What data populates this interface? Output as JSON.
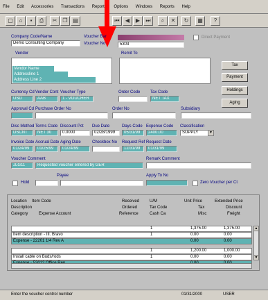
{
  "menu": [
    "File",
    "Edit",
    "Accessories",
    "Transactions",
    "Reports",
    "Options",
    "Windows",
    "Reports",
    "Help"
  ],
  "toolbar": [
    "new",
    "open",
    "save",
    "print",
    "cut",
    "copy",
    "paste",
    "first",
    "prev",
    "next",
    "last",
    "find",
    "delete",
    "refresh",
    "calc",
    "help"
  ],
  "header": {
    "company_label": "Company Code/Name",
    "company_code": "Demo Consulting Company",
    "vendor_label": "Vendor",
    "vendor_name": "Vendor Name",
    "vendor_address": [
      "Addressline 1",
      "Address Line 2"
    ],
    "voucher_label": "Voucher Bar",
    "voucher_no_label": "Voucher No",
    "voucher_no": "5303",
    "remit_label": "Remit To",
    "check_label": "Direct Payment"
  },
  "side_buttons": [
    "Tax",
    "Payment",
    "Holdings",
    "Aging"
  ],
  "row1": {
    "labels": [
      "Currency Cd",
      "Vendor Cont",
      "Voucher Type",
      "Order Code",
      "Tax Code"
    ],
    "values": [
      "USD",
      "AAB",
      "1 - VOUCHER",
      "",
      "NET TAX"
    ]
  },
  "row2": {
    "labels": [
      "Approval Cd",
      "Purchase Order No",
      "Order No",
      "Subsidiary"
    ]
  },
  "row3": {
    "labels": [
      "Disc Method",
      "Terms Code",
      "Discount Pct",
      "Due Date",
      "Days Code",
      "Expense Code",
      "Classification"
    ],
    "values": [
      "DSCNT",
      "NET 30",
      "0.0000",
      "02/28/1999",
      "05/31/99",
      "2400.00",
      "SUPPLY"
    ]
  },
  "row4": {
    "labels": [
      "Invoice Date",
      "Accrual Date",
      "Aging Date",
      "Checkbox No",
      "Request Ref",
      "Request Date"
    ],
    "values": [
      "01/24/99",
      "01/25/99",
      "01/24/99",
      "",
      "12/31/99",
      "01/31/99"
    ]
  },
  "row5": {
    "labels": [
      "Voucher Comment",
      "Remark Comment"
    ],
    "values": [
      "JLG11",
      "Requested voucher entered by GER"
    ]
  },
  "row6": {
    "hold_label": "Hold",
    "payee_label": "Payee",
    "apply_label": "Apply To No",
    "zero_label": "Zero Voucher per Ct"
  },
  "grid_header": {
    "line1": [
      "Location",
      "Item Code",
      "Received",
      "U/M",
      "Unit Price",
      "Extended Price"
    ],
    "line2": [
      "Description",
      "Ordered",
      "Tax Code",
      "Tax",
      "Discount"
    ],
    "line3": [
      "Category",
      "Expense Account",
      "Reference",
      "Cash Ca",
      "Misc",
      "Freight"
    ]
  },
  "grid_rows": [
    {
      "a": "",
      "b": "1",
      "c": "1,375.00",
      "d": "1,375.00",
      "hl": false
    },
    {
      "a": "Item description - III. Bravo",
      "b": "1",
      "c": "0.00",
      "d": "0.00",
      "hl": false
    },
    {
      "a": "Expense - 22201 1/4 Rev A",
      "b": "",
      "c": "0.00",
      "d": "0.00",
      "hl": true
    },
    {
      "a": "",
      "b": "1",
      "c": "1,200.00",
      "d": "1,000.00",
      "hl": false
    },
    {
      "a": "Install cable on Buds/rods",
      "b": "1",
      "c": "0.00",
      "d": "0.00",
      "hl": false
    },
    {
      "a": "Expense - 53012 Office Ren",
      "b": "",
      "c": "0.00",
      "d": "0.00",
      "hl": true
    }
  ],
  "status": {
    "message": "Enter the voucher control number",
    "date": "01/31/2000",
    "user": "USER"
  },
  "colors": {
    "teal": "#5fb3b3",
    "magenta": "#b4508c",
    "navy": "#000080",
    "arrow": "#ff0000"
  }
}
